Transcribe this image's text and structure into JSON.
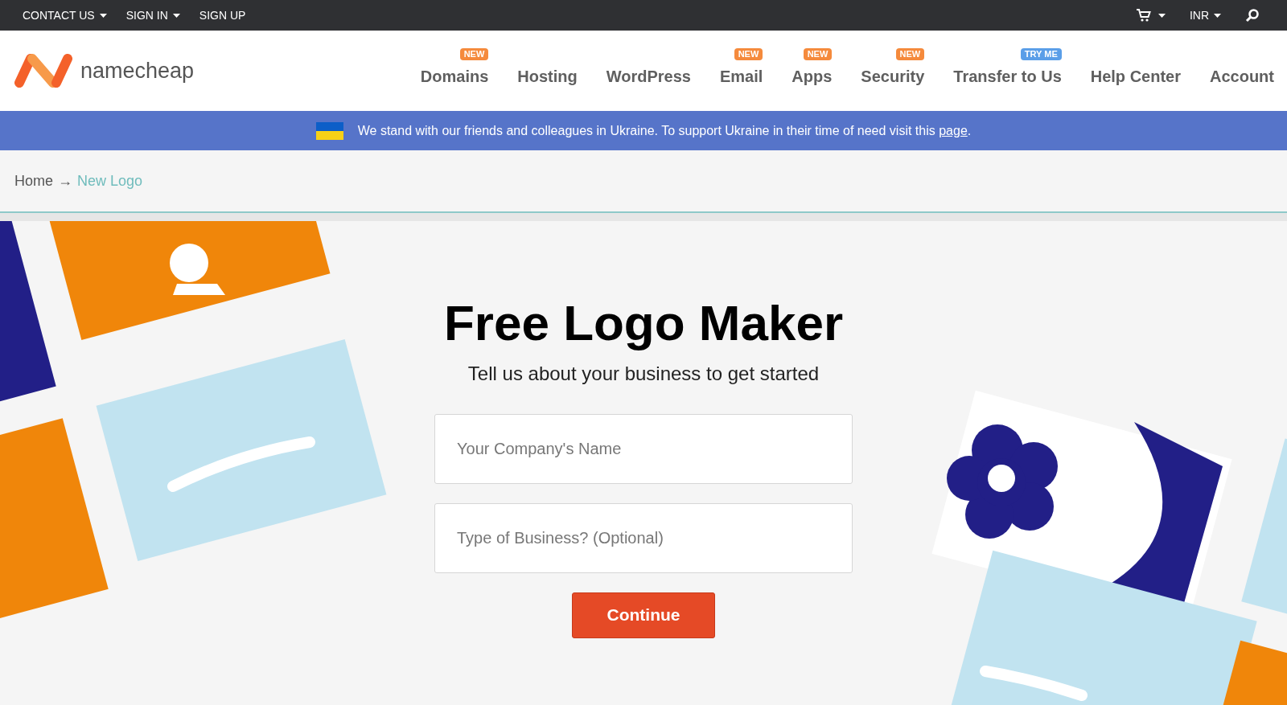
{
  "top_bar": {
    "left_links": [
      {
        "label": "CONTACT US",
        "dropdown": true
      },
      {
        "label": "SIGN IN",
        "dropdown": true
      },
      {
        "label": "SIGN UP",
        "dropdown": false
      }
    ],
    "currency": "INR"
  },
  "header": {
    "logo_text": "namecheap",
    "nav": [
      {
        "label": "Domains",
        "badge": {
          "label": "NEW",
          "color": "#f58a3c"
        }
      },
      {
        "label": "Hosting"
      },
      {
        "label": "WordPress"
      },
      {
        "label": "Email",
        "badge": {
          "label": "NEW",
          "color": "#f58a3c"
        }
      },
      {
        "label": "Apps",
        "badge": {
          "label": "NEW",
          "color": "#f58a3c"
        }
      },
      {
        "label": "Security",
        "badge": {
          "label": "NEW",
          "color": "#f58a3c"
        }
      },
      {
        "label": "Transfer to Us",
        "badge": {
          "label": "TRY ME",
          "color": "#5a9ee8"
        }
      },
      {
        "label": "Help Center"
      },
      {
        "label": "Account"
      }
    ]
  },
  "banner": {
    "text": "We stand with our friends and colleagues in Ukraine. To support Ukraine in their time of need visit this",
    "link": "page",
    "tail": "."
  },
  "breadcrumb": {
    "items": [
      {
        "label": "Home",
        "current": false
      },
      {
        "label": "New Logo",
        "current": true
      }
    ],
    "separator": "→"
  },
  "hero": {
    "title": "Free Logo Maker",
    "subtitle": "Tell us about your business to get started",
    "fields": [
      {
        "placeholder": "Your Company's Name"
      },
      {
        "placeholder": "Type of Business? (Optional)"
      }
    ],
    "button": "Continue"
  }
}
